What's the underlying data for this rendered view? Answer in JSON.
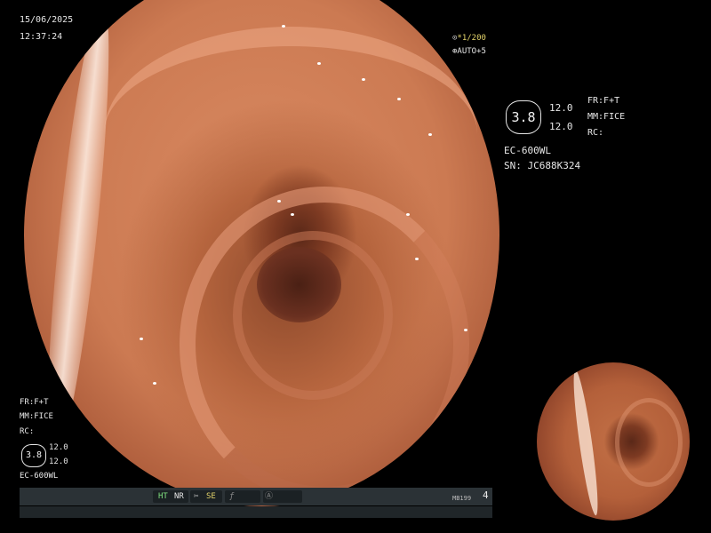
{
  "datetime": {
    "date": "15/06/2025",
    "time": "12:37:24"
  },
  "shutter": {
    "icon": "shutter-icon",
    "value": "1/200",
    "value_color": "#e3d36a",
    "auto_icon": "auto-iris-icon",
    "auto": "AUTO+5"
  },
  "settings_right": {
    "box_value": "3.8",
    "v1": "12.0",
    "v2": "12.0",
    "fr": "FR:F+T",
    "mm": "MM:FICE",
    "rc": "RC:",
    "scope": "EC-600WL",
    "sn": "SN: JC688K324"
  },
  "settings_left": {
    "fr": "FR:F+T",
    "mm": "MM:FICE",
    "rc": "RC:",
    "box_value": "3.8",
    "v1": "12.0",
    "v2": "12.0",
    "scope": "EC-600WL"
  },
  "statusbar": {
    "ht": "HT",
    "nr": "NR",
    "se": "SE",
    "se_icon": "scissor-icon",
    "f_icon": "italic-f-icon",
    "a_icon": "circle-a-icon",
    "code": "MB199",
    "number": "4",
    "colors": {
      "ht": "#7fe07f",
      "nr": "#e6e6e6",
      "se": "#e3d36a"
    }
  }
}
